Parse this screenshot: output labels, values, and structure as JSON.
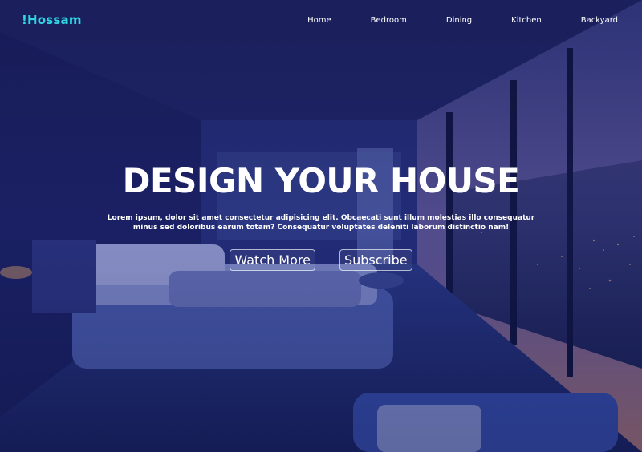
{
  "brand": {
    "logo_text": "!Hossam",
    "accent": "#2fd7e6"
  },
  "nav": {
    "links": [
      {
        "label": "Home"
      },
      {
        "label": "Bedroom"
      },
      {
        "label": "Dining"
      },
      {
        "label": "Kitchen"
      },
      {
        "label": "Backyard"
      }
    ]
  },
  "hero": {
    "title": "DESIGN YOUR HOUSE",
    "subtitle": "Lorem ipsum, dolor sit amet consectetur adipisicing elit. Obcaecati sunt illum molestias illo consequatur minus sed doloribus earum totam? Consequatur voluptates deleniti laborum distinctio nam!",
    "buttons": {
      "watch_more": "Watch More",
      "subscribe": "Subscribe"
    }
  }
}
